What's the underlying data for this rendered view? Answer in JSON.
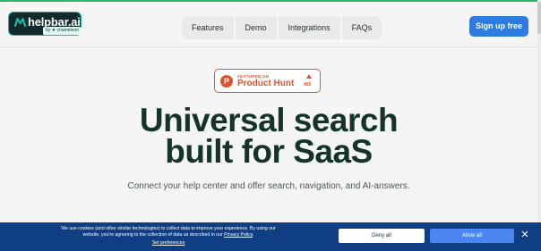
{
  "brand": {
    "name": "helpbar.ai",
    "byline": "by ★ chameleon",
    "colors": {
      "logo_bg": "#112b2a",
      "accent": "#17c1b2",
      "primary": "#2f7ce0"
    }
  },
  "nav": {
    "items": [
      {
        "label": "Features"
      },
      {
        "label": "Demo"
      },
      {
        "label": "Integrations"
      },
      {
        "label": "FAQs"
      }
    ]
  },
  "header": {
    "signup_label": "Sign up free"
  },
  "product_hunt": {
    "featured_label": "FEATURED ON",
    "name": "Product Hunt",
    "votes": "465",
    "icon": "P",
    "color": "#da552f"
  },
  "hero": {
    "title_line1": "Universal search",
    "title_line2": "built for SaaS",
    "tagline": "Connect your help center and offer search, navigation, and AI-answers."
  },
  "cookie_banner": {
    "message_before_link": "We use cookies (and other similar technologies) to collect data to improve your experience. By using our website, you're agreeing to the collection of data as described in our ",
    "policy_link": "Privacy Policy",
    "message_after_link": ".",
    "preferences_label": "Set preferences",
    "deny_label": "Deny all",
    "allow_label": "Allow all",
    "close_icon": "✕",
    "colors": {
      "background": "#0f3e82",
      "allow": "#4b87f3"
    }
  }
}
